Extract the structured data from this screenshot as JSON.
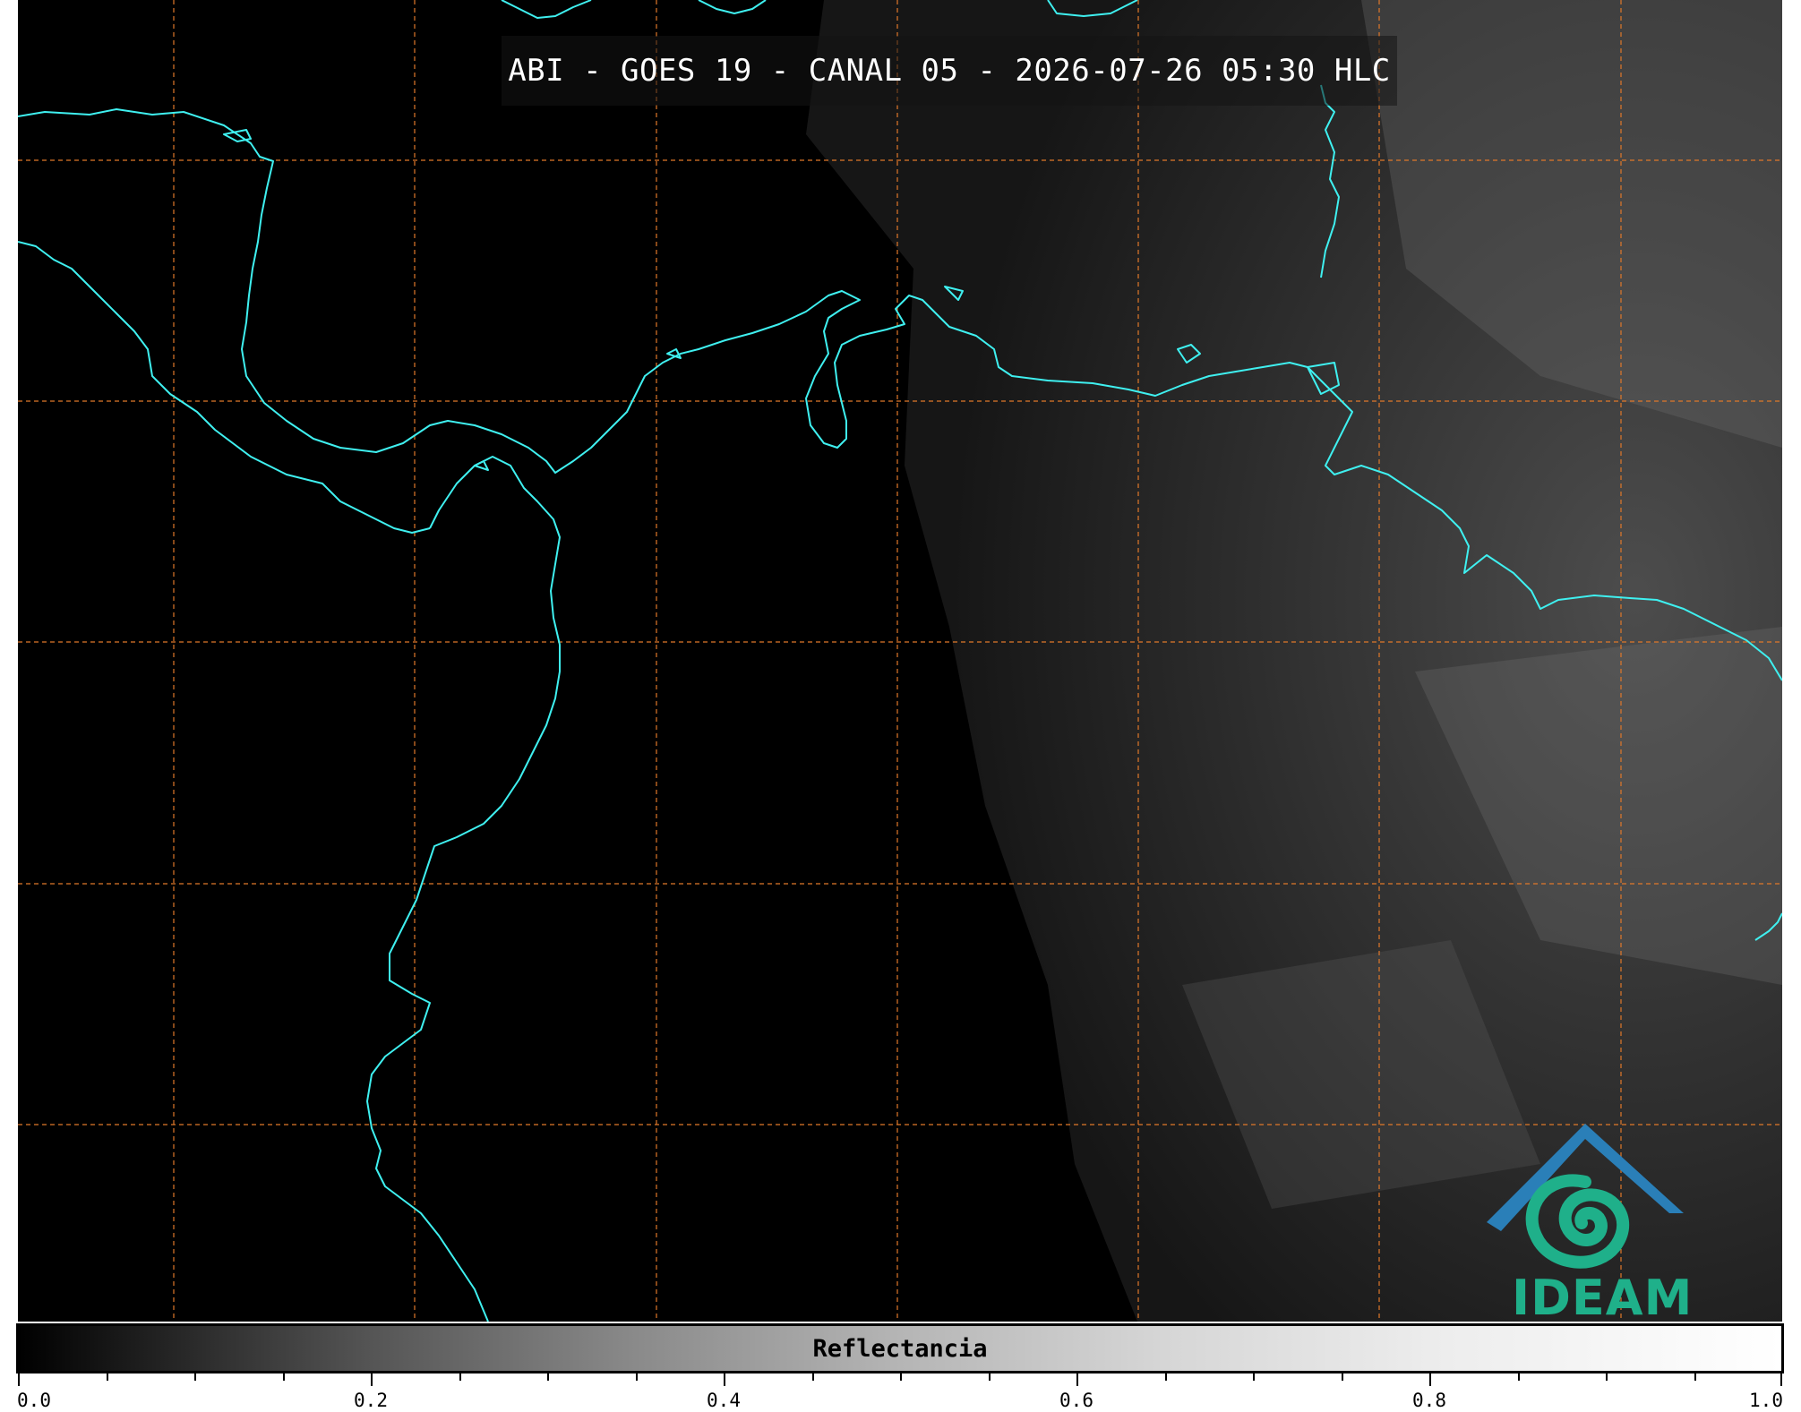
{
  "title": "ABI - GOES 19 - CANAL 05 - 2026-07-26 05:30 HLC",
  "colorbar": {
    "label": "Reflectancia",
    "range": [
      0.0,
      1.0
    ],
    "tick_labels": [
      "0.0",
      "0.2",
      "0.4",
      "0.6",
      "0.8",
      "1.0"
    ],
    "colors": [
      "#000000",
      "#ffffff"
    ]
  },
  "logo": {
    "text": "IDEAM",
    "colors": {
      "mountain": "#2a7fb8",
      "swirl": "#1fb08a"
    }
  },
  "map": {
    "background": "#000000",
    "coastline_color": "#3ff0f0",
    "gridline_color": "#e0782a",
    "gridlines": "dashed"
  }
}
